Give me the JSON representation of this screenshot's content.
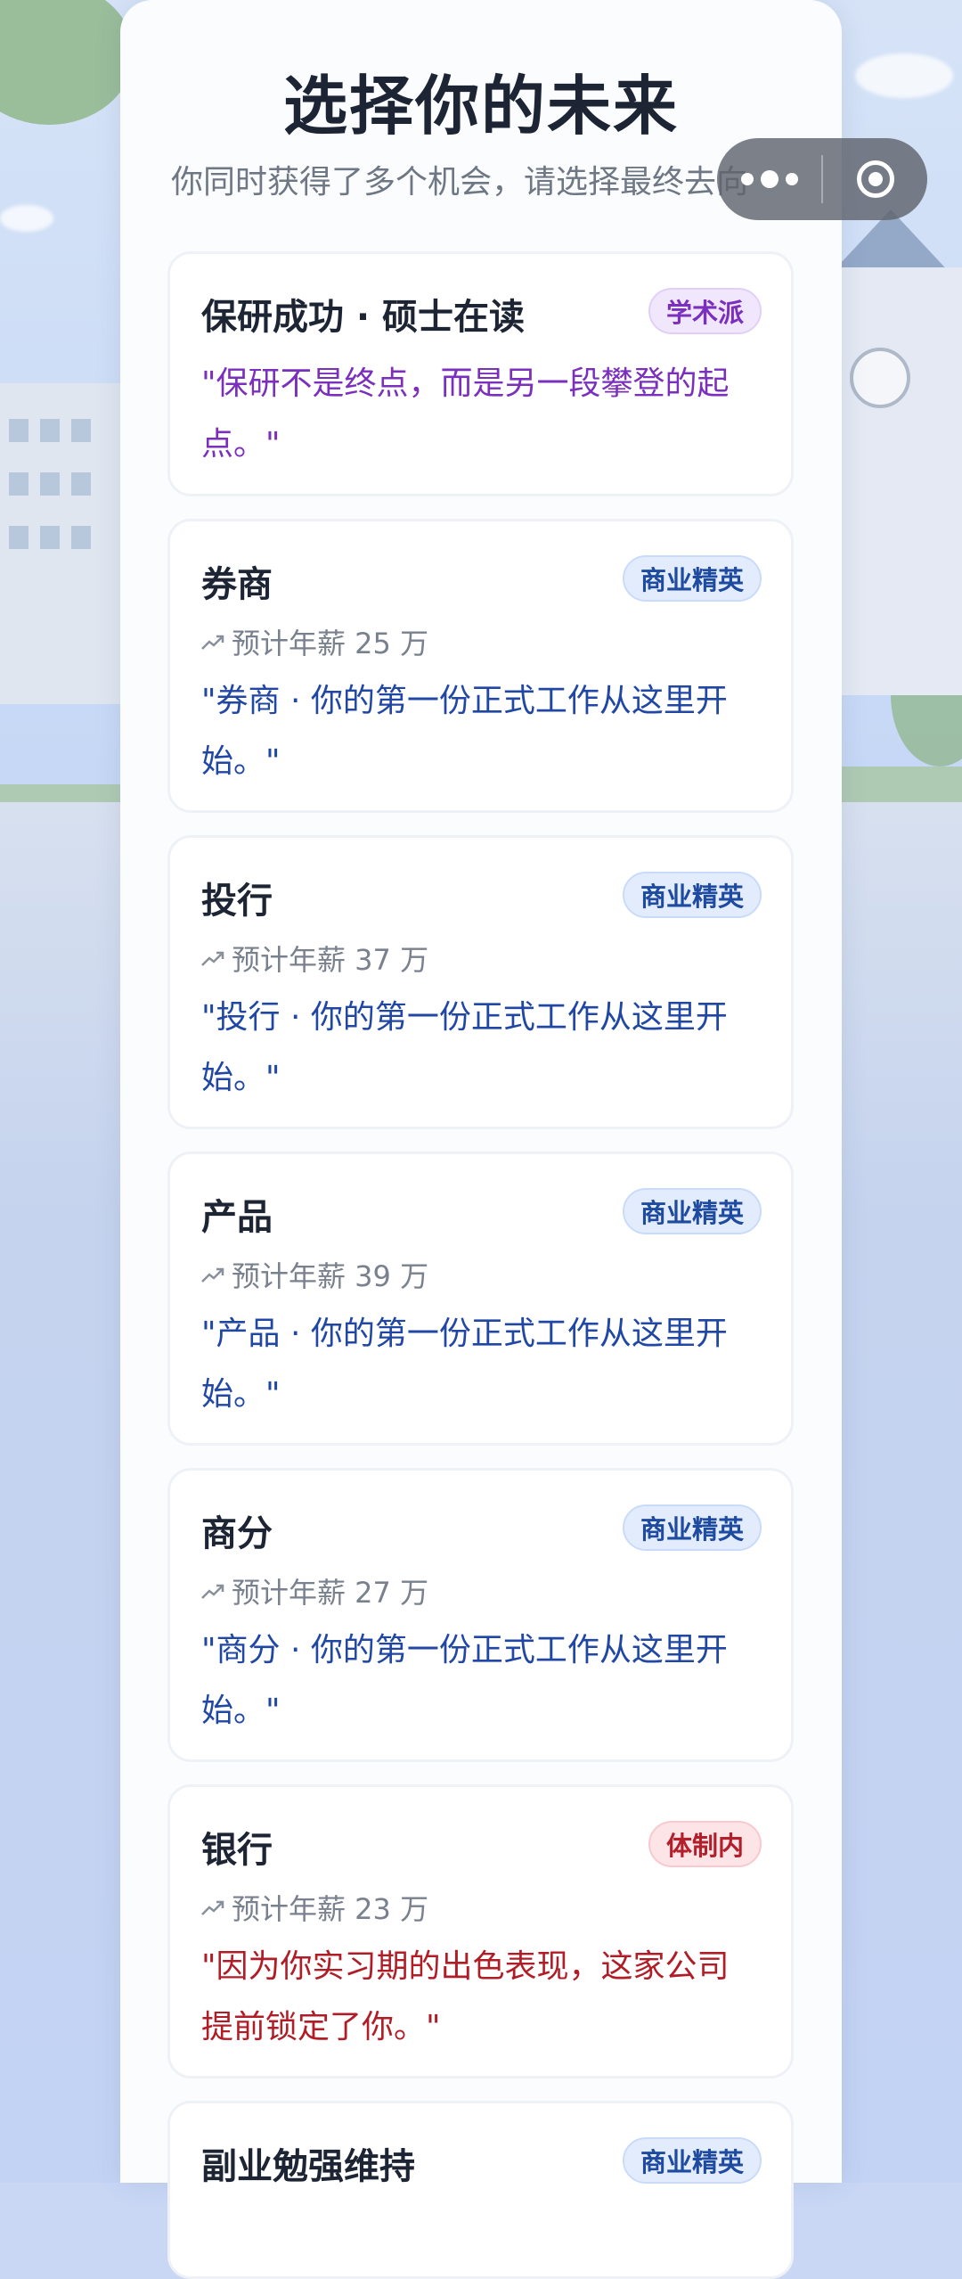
{
  "page": {
    "title": "选择你的未来",
    "subtitle": "你同时获得了多个机会，请选择最终去向"
  },
  "capsule": {
    "more_icon": "more-dots-icon",
    "close_icon": "close-target-icon"
  },
  "colors": {
    "academic": "#7b2fbd",
    "business": "#2147a4",
    "state": "#b01d26",
    "title": "#1d2433"
  },
  "cards": [
    {
      "name": "保研成功 · 硕士在读",
      "badge": "学术派",
      "badge_type": "academic",
      "salary": "",
      "quote": "\"保研不是终点，而是另一段攀登的起点。\""
    },
    {
      "name": "券商",
      "badge": "商业精英",
      "badge_type": "business",
      "salary": "预计年薪 25 万",
      "quote": "\"券商 · 你的第一份正式工作从这里开始。\""
    },
    {
      "name": "投行",
      "badge": "商业精英",
      "badge_type": "business",
      "salary": "预计年薪 37 万",
      "quote": "\"投行 · 你的第一份正式工作从这里开始。\""
    },
    {
      "name": "产品",
      "badge": "商业精英",
      "badge_type": "business",
      "salary": "预计年薪 39 万",
      "quote": "\"产品 · 你的第一份正式工作从这里开始。\""
    },
    {
      "name": "商分",
      "badge": "商业精英",
      "badge_type": "business",
      "salary": "预计年薪 27 万",
      "quote": "\"商分 · 你的第一份正式工作从这里开始。\""
    },
    {
      "name": "银行",
      "badge": "体制内",
      "badge_type": "state",
      "salary": "预计年薪 23 万",
      "quote": "\"因为你实习期的出色表现，这家公司提前锁定了你。\""
    },
    {
      "name": "副业勉强维持",
      "badge": "商业精英",
      "badge_type": "business",
      "salary": "",
      "quote": ""
    }
  ]
}
